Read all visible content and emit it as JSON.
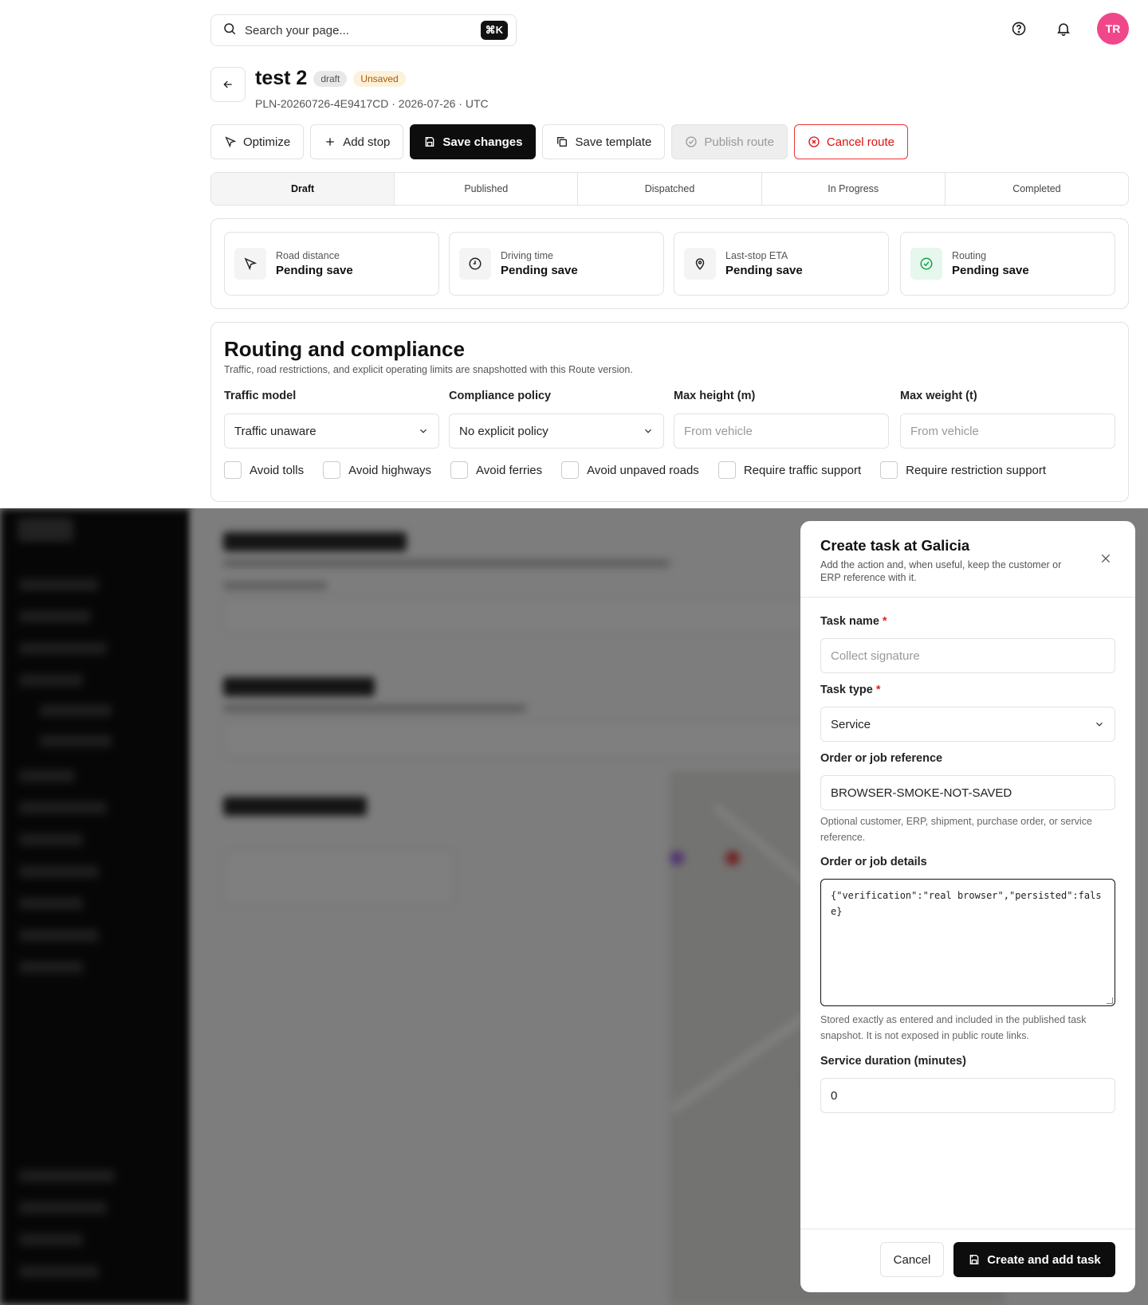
{
  "topbar": {
    "search_placeholder": "Search your page...",
    "shortcut": "⌘K",
    "avatar_initials": "TR"
  },
  "header": {
    "title": "test 2",
    "status_badge": "draft",
    "unsaved_badge": "Unsaved",
    "subtitle": "PLN-20260726-4E9417CD · 2026-07-26 · UTC"
  },
  "toolbar": {
    "optimize": "Optimize",
    "add_stop": "Add stop",
    "save_changes": "Save changes",
    "save_template": "Save template",
    "publish_route": "Publish route",
    "cancel_route": "Cancel route"
  },
  "steps": [
    "Draft",
    "Published",
    "Dispatched",
    "In Progress",
    "Completed"
  ],
  "stats": [
    {
      "label": "Road distance",
      "value": "Pending save",
      "icon": "cursor-icon"
    },
    {
      "label": "Driving time",
      "value": "Pending save",
      "icon": "clock-icon"
    },
    {
      "label": "Last-stop ETA",
      "value": "Pending save",
      "icon": "map-pin-icon"
    },
    {
      "label": "Routing",
      "value": "Pending save",
      "icon": "check-circle-icon"
    }
  ],
  "routing": {
    "title": "Routing and compliance",
    "description": "Traffic, road restrictions, and explicit operating limits are snapshotted with this Route version.",
    "traffic_model_label": "Traffic model",
    "traffic_model_value": "Traffic unaware",
    "compliance_label": "Compliance policy",
    "compliance_value": "No explicit policy",
    "max_height_label": "Max height (m)",
    "max_height_placeholder": "From vehicle",
    "max_weight_label": "Max weight (t)",
    "max_weight_placeholder": "From vehicle",
    "checks": [
      "Avoid tolls",
      "Avoid highways",
      "Avoid ferries",
      "Avoid unpaved roads",
      "Require traffic support",
      "Require restriction support"
    ]
  },
  "dialog": {
    "title": "Create task at Galicia",
    "description": "Add the action and, when useful, keep the customer or ERP reference with it.",
    "task_name_label": "Task name",
    "task_name_placeholder": "Collect signature",
    "required_mark": "*",
    "task_type_label": "Task type",
    "task_type_value": "Service",
    "order_ref_label": "Order or job reference",
    "order_ref_value": "BROWSER-SMOKE-NOT-SAVED",
    "order_ref_help": "Optional customer, ERP, shipment, purchase order, or service reference.",
    "order_details_label": "Order or job details",
    "order_details_value": "{\"verification\":\"real browser\",\"persisted\":false}",
    "order_details_help": "Stored exactly as entered and included in the published task snapshot. It is not exposed in public route links.",
    "service_duration_label": "Service duration (minutes)",
    "service_duration_value": "0",
    "cancel": "Cancel",
    "create": "Create and add task"
  },
  "colors": {
    "accent": "#0d0d0d",
    "avatar": "#f0478a",
    "danger": "#dd1111",
    "unsaved_bg": "#fdf1dc",
    "success": "#16a34a"
  }
}
